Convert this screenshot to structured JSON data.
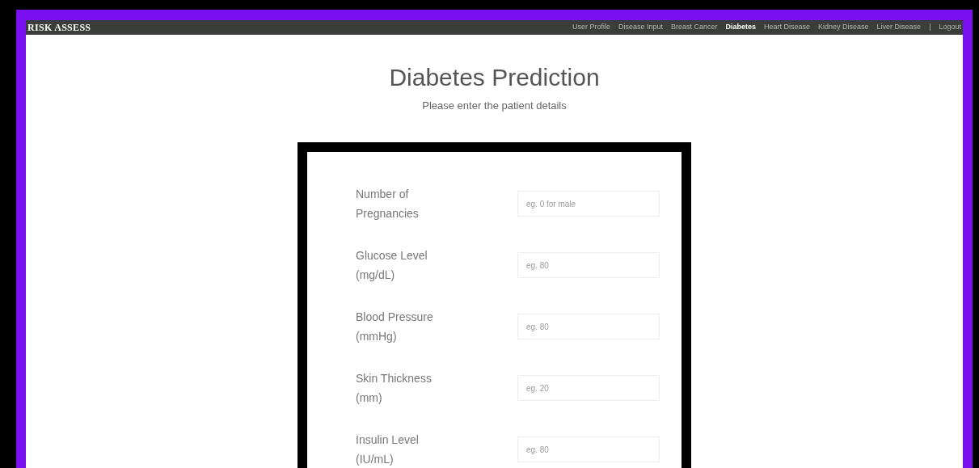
{
  "navbar": {
    "brand": "RISK ASSESS",
    "links": [
      {
        "label": "User Profile",
        "selected": false
      },
      {
        "label": "Disease Input",
        "selected": false
      },
      {
        "label": "Breast Cancer",
        "selected": false
      },
      {
        "label": "Diabetes",
        "selected": true
      },
      {
        "label": "Heart Disease",
        "selected": false
      },
      {
        "label": "Kidney Disease",
        "selected": false
      },
      {
        "label": "Liver Disease",
        "selected": false
      },
      {
        "label": "Logout",
        "selected": false
      }
    ],
    "separator": "|"
  },
  "header": {
    "title": "Diabetes Prediction",
    "subtitle": "Please enter the patient details"
  },
  "form": {
    "fields": [
      {
        "label": "Number of Pregnancies",
        "placeholder": "eg. 0 for male"
      },
      {
        "label": "Glucose Level (mg/dL)",
        "placeholder": "eg. 80"
      },
      {
        "label": "Blood Pressure (mmHg)",
        "placeholder": "eg. 80"
      },
      {
        "label": "Skin Thickness (mm)",
        "placeholder": "eg. 20"
      },
      {
        "label": "Insulin Level (IU/mL)",
        "placeholder": "eg. 80"
      }
    ]
  }
}
